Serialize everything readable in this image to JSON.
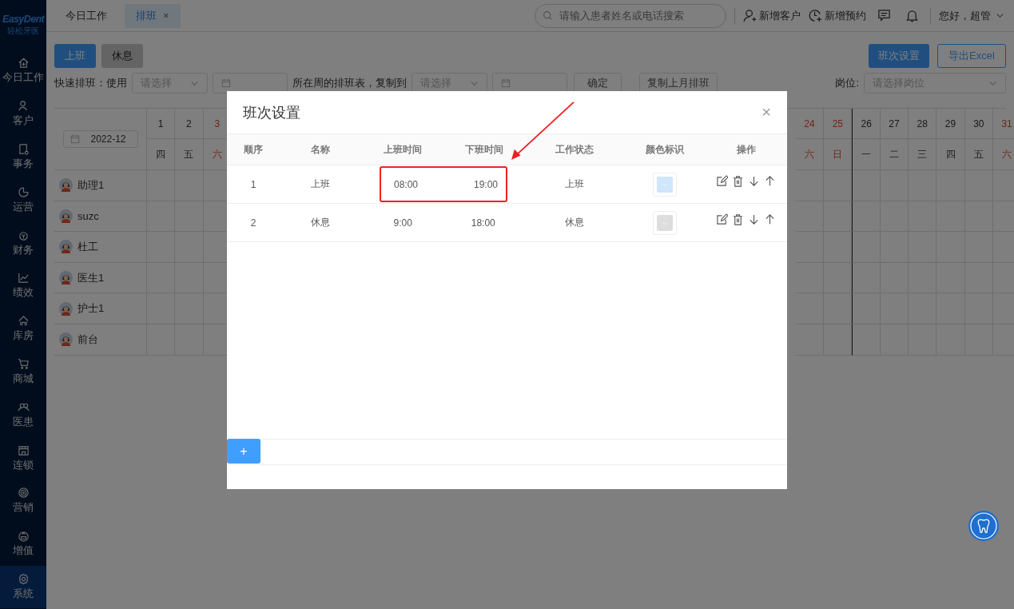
{
  "sidebar": {
    "logo": "EasyDent",
    "logo_subtitle": "轻松牙医",
    "items": [
      {
        "label": "今日工作",
        "selected": false
      },
      {
        "label": "客户",
        "selected": false
      },
      {
        "label": "事务",
        "selected": false
      },
      {
        "label": "运营",
        "selected": false
      },
      {
        "label": "财务",
        "selected": false
      },
      {
        "label": "绩效",
        "selected": false
      },
      {
        "label": "库房",
        "selected": false
      },
      {
        "label": "商城",
        "selected": false
      },
      {
        "label": "医患",
        "selected": false
      },
      {
        "label": "连锁",
        "selected": false
      },
      {
        "label": "营销",
        "selected": false
      },
      {
        "label": "增值",
        "selected": false
      },
      {
        "label": "系统",
        "selected": true
      }
    ]
  },
  "tabs": [
    {
      "label": "今日工作",
      "selected": false,
      "closable": false
    },
    {
      "label": "排班",
      "selected": true,
      "closable": true
    }
  ],
  "close_glyph": "×",
  "header": {
    "search_placeholder": "请输入患者姓名或电话搜索",
    "add_customer": "新增客户",
    "add_appointment": "新增预约",
    "greeting": "您好，超管"
  },
  "toolbar": {
    "shift_buttons": [
      {
        "label": "上班",
        "kind": "work"
      },
      {
        "label": "休息",
        "kind": "rest"
      }
    ],
    "shift_settings": "班次设置",
    "export": "导出Excel"
  },
  "quick": {
    "label": "快速排班：使用",
    "select1": "请选择",
    "middle": "所在周的排班表，复制到",
    "select2": "请选择",
    "confirm": "确定",
    "copy_last": "复制上月排班",
    "post_label": "岗位:",
    "post_placeholder": "请选择岗位"
  },
  "calendar": {
    "month": "2022-12",
    "days": [
      {
        "day": "1",
        "weekday": "四",
        "weekend": false
      },
      {
        "day": "2",
        "weekday": "五",
        "weekend": false
      },
      {
        "day": "3",
        "weekday": "六",
        "weekend": true
      },
      {
        "day": "24",
        "weekday": "六",
        "weekend": true
      },
      {
        "day": "25",
        "weekday": "日",
        "weekend": true
      },
      {
        "day": "26",
        "weekday": "一",
        "weekend": false
      },
      {
        "day": "27",
        "weekday": "二",
        "weekend": false
      },
      {
        "day": "28",
        "weekday": "三",
        "weekend": false
      },
      {
        "day": "29",
        "weekday": "四",
        "weekend": false
      },
      {
        "day": "30",
        "weekday": "五",
        "weekend": false
      },
      {
        "day": "31",
        "weekday": "六",
        "weekend": true
      }
    ],
    "staff": [
      "助理1",
      "suzc",
      "杜工",
      "医生1",
      "护士1",
      "前台"
    ]
  },
  "dialog": {
    "title": "班次设置",
    "close": "×",
    "columns": [
      "顺序",
      "名称",
      "上班时间",
      "下班时间",
      "工作状态",
      "颜色标识",
      "操作"
    ],
    "rows": [
      {
        "order": "1",
        "name": "上班",
        "start": "08:00",
        "end": "19:00",
        "status": "上班",
        "color": "#cfe6fb",
        "highlighted": true
      },
      {
        "order": "2",
        "name": "休息",
        "start": "9:00",
        "end": "18:00",
        "status": "休息",
        "color": "#dddddd",
        "highlighted": false
      }
    ],
    "add": "+"
  }
}
